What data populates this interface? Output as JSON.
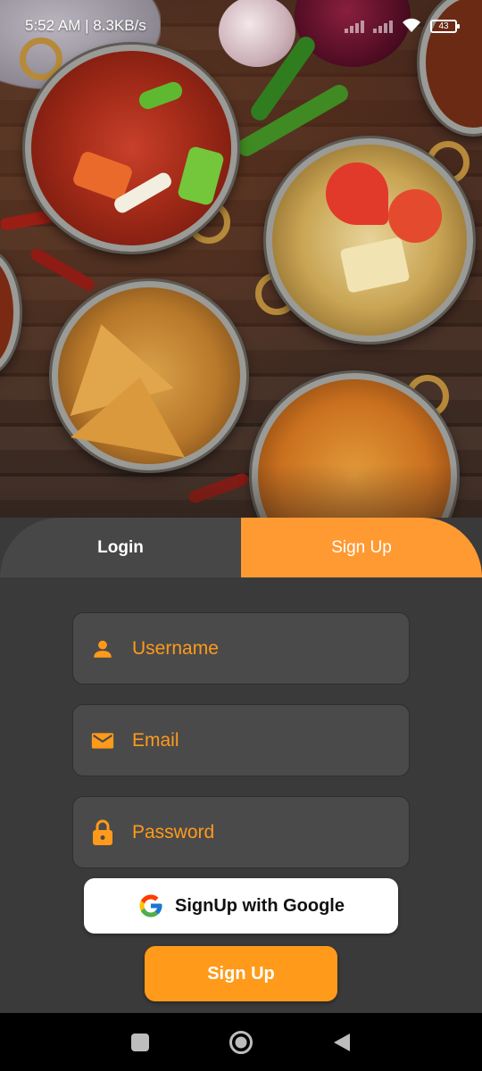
{
  "status_bar": {
    "time_speed": "5:52 AM | 8.3KB/s",
    "battery_level": "43",
    "icons": [
      "signal-icon",
      "wifi-icon",
      "battery-icon"
    ]
  },
  "hero": {
    "alt": "Assorted Indian dishes in copper bowls"
  },
  "tabs": {
    "login_label": "Login",
    "signup_label": "Sign Up",
    "active": "signup"
  },
  "form": {
    "username_placeholder": "Username",
    "email_placeholder": "Email",
    "password_placeholder": "Password",
    "google_label": "SignUp with Google",
    "submit_label": "Sign Up"
  },
  "colors": {
    "accent": "#ff9a1a",
    "panel": "#3a3a3a",
    "field": "#4a4a4a"
  },
  "nav": {
    "icons": [
      "recent-apps-icon",
      "home-icon",
      "back-icon"
    ]
  }
}
